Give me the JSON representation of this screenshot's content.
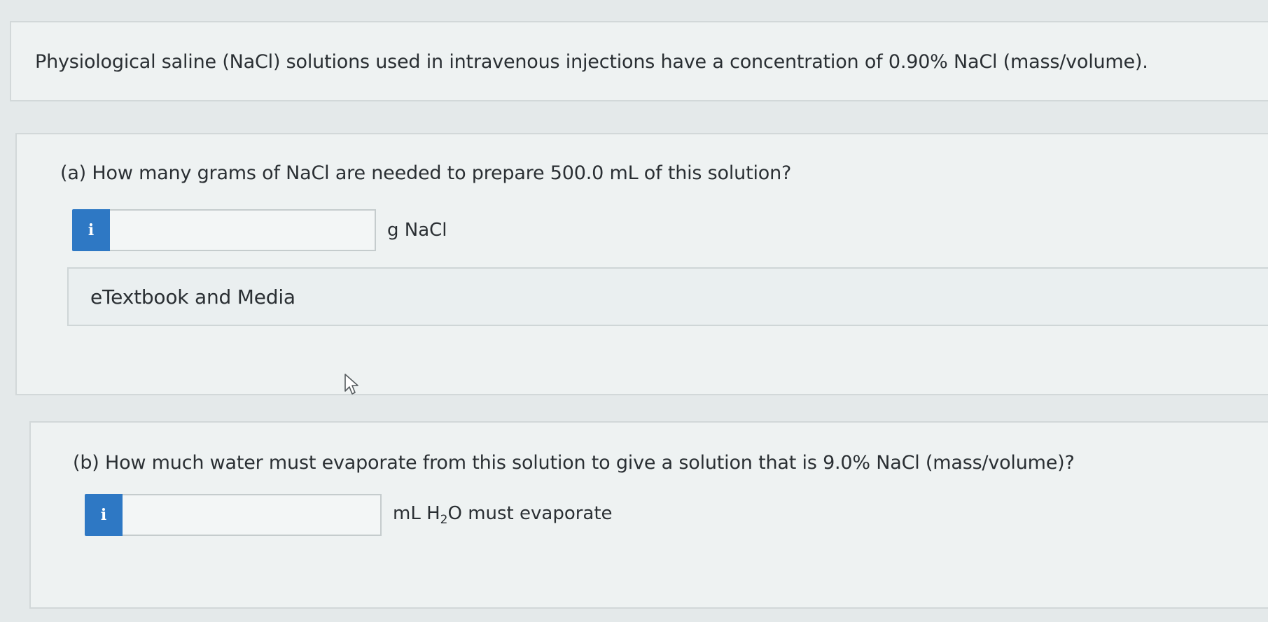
{
  "intro": {
    "text": "Physiological saline (NaCl) solutions used in intravenous injections have a concentration of 0.90% NaCl (mass/volume)."
  },
  "part_a": {
    "question": "(a) How many grams of NaCl are needed to prepare 500.0 mL of this solution?",
    "info_icon": "i",
    "input_value": "",
    "unit": "g NaCl",
    "etextbook_label": "eTextbook and Media"
  },
  "part_b": {
    "question": "(b) How much water must evaporate from this solution to give a solution that is 9.0% NaCl (mass/volume)?",
    "info_icon": "i",
    "input_value": "",
    "unit_prefix": "mL H",
    "unit_sub": "2",
    "unit_suffix": "O must evaporate"
  },
  "colors": {
    "info_button": "#2e78c4",
    "background": "#e4e9ea",
    "panel": "#eef2f2"
  },
  "icons": {
    "info": "info-icon",
    "cursor": "mouse-pointer-icon"
  }
}
